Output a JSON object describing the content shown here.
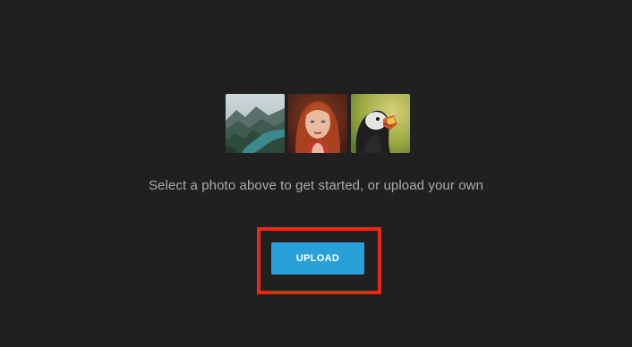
{
  "thumbnails": [
    {
      "icon": "landscape-lake-photo",
      "subject": "mountain lake valley"
    },
    {
      "icon": "portrait-woman-photo",
      "subject": "red-haired woman portrait"
    },
    {
      "icon": "puffin-bird-photo",
      "subject": "puffin bird"
    }
  ],
  "prompt_text": "Select a photo above to get started, or upload your own",
  "upload_button": {
    "label": "UPLOAD"
  },
  "colors": {
    "background": "#202020",
    "accent": "#2aa0d8",
    "highlight": "#e82a14",
    "prompt_text": "#a9a9a9"
  }
}
